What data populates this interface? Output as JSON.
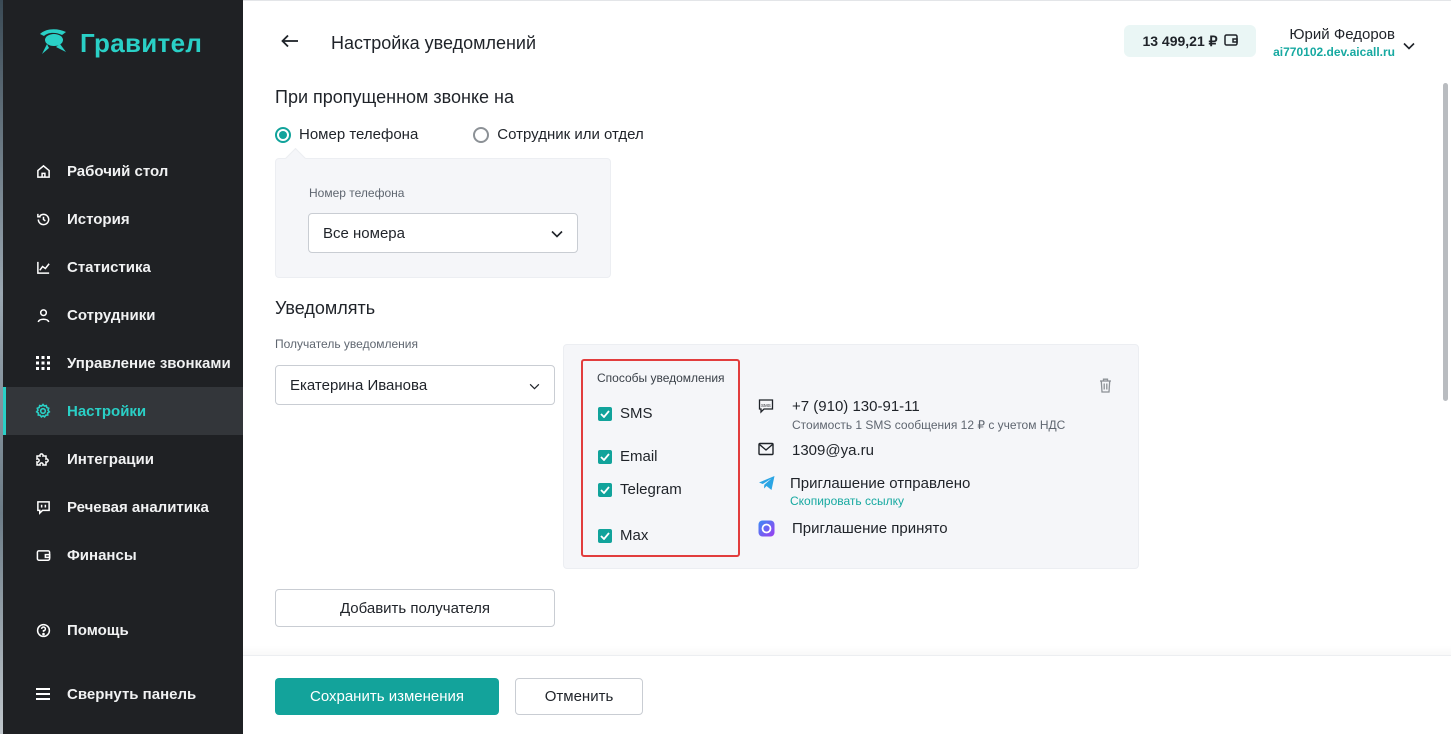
{
  "app": {
    "logo_text": "Гравител"
  },
  "sidebar": {
    "items": [
      {
        "label": "Рабочий стол",
        "icon": "home-icon"
      },
      {
        "label": "История",
        "icon": "history-icon"
      },
      {
        "label": "Статистика",
        "icon": "chart-icon"
      },
      {
        "label": "Сотрудники",
        "icon": "user-icon"
      },
      {
        "label": "Управление звонками",
        "icon": "grid-icon"
      },
      {
        "label": "Настройки",
        "icon": "gear-icon",
        "active": true
      },
      {
        "label": "Интеграции",
        "icon": "puzzle-icon"
      },
      {
        "label": "Речевая аналитика",
        "icon": "speech-icon"
      },
      {
        "label": "Финансы",
        "icon": "wallet-icon"
      },
      {
        "label": "Помощь",
        "icon": "help-icon"
      },
      {
        "label": "Свернуть панель",
        "icon": "menu-icon"
      }
    ]
  },
  "header": {
    "title": "Настройка уведомлений",
    "balance": "13 499,21 ₽",
    "user_name": "Юрий Федоров",
    "user_domain": "ai770102.dev.aicall.ru"
  },
  "missed_call": {
    "title": "При пропущенном звонке на",
    "options": [
      "Номер телефона",
      "Сотрудник или отдел"
    ],
    "selected": "Номер телефона",
    "phone_label": "Номер телефона",
    "phone_value": "Все номера"
  },
  "notify": {
    "title": "Уведомлять",
    "recipient_label": "Получатель уведомления",
    "recipient_value": "Екатерина Иванова",
    "methods_title": "Способы уведомления",
    "methods": [
      {
        "label": "SMS",
        "checked": true
      },
      {
        "label": "Email",
        "checked": true
      },
      {
        "label": "Telegram",
        "checked": true
      },
      {
        "label": "Max",
        "checked": true
      }
    ],
    "contacts": {
      "sms_value": "+7 (910) 130-91-11",
      "sms_note": "Стоимость 1 SMS сообщения 12 ₽ с учетом НДС",
      "email_value": "1309@ya.ru",
      "telegram_status": "Приглашение отправлено",
      "telegram_link": "Скопировать ссылку",
      "max_status": "Приглашение принято"
    },
    "add_recipient": "Добавить получателя"
  },
  "footer": {
    "save": "Сохранить изменения",
    "cancel": "Отменить"
  },
  "colors": {
    "accent": "#13a39b",
    "sidebar_bg": "#1f2124",
    "highlight": "#e23d3d"
  }
}
